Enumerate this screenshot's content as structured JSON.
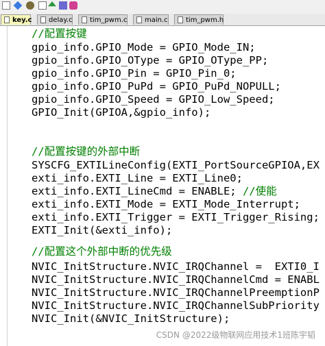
{
  "tabs": [
    {
      "label": "key.c",
      "active": true
    },
    {
      "label": "delay.c",
      "active": false
    },
    {
      "label": "tim_pwm.c",
      "active": false
    },
    {
      "label": "main.c",
      "active": false
    },
    {
      "label": "tim_pwm.h",
      "active": false
    }
  ],
  "code": {
    "l1": "//配置按键",
    "l2": "gpio_info.GPIO_Mode = GPIO_Mode_IN;",
    "l3": "gpio_info.GPIO_OType = GPIO_OType_PP;",
    "l4": "gpio_info.GPIO_Pin = GPIO_Pin_0;",
    "l5": "gpio_info.GPIO_PuPd = GPIO_PuPd_NOPULL;",
    "l6": "gpio_info.GPIO_Speed = GPIO_Low_Speed;",
    "l7": "GPIO_Init(GPIOA,&gpio_info);",
    "l8": "//配置按键的外部中断",
    "l9": "SYSCFG_EXTILineConfig(EXTI_PortSourceGPIOA,EX",
    "l10": "exti_info.EXTI_Line = EXTI_Line0;",
    "l11a": "exti_info.EXTI_LineCmd = ENABLE; ",
    "l11b": "//使能",
    "l12": "exti_info.EXTI_Mode = EXTI_Mode_Interrupt;",
    "l13": "exti_info.EXTI_Trigger = EXTI_Trigger_Rising;",
    "l14": "EXTI_Init(&exti_info);",
    "l15": "//配置这个外部中断的优先级",
    "l16": "NVIC_InitStructure.NVIC_IRQChannel =  EXTI0_I",
    "l17": "NVIC_InitStructure.NVIC_IRQChannelCmd = ENABL",
    "l18": "NVIC_InitStructure.NVIC_IRQChannelPreemptionP",
    "l19": "NVIC_InitStructure.NVIC_IRQChannelSubPriority",
    "l20": "NVIC_Init(&NVIC_InitStructure);"
  },
  "watermark": "CSDN @2022级物联网应用技术1班陈宇韬"
}
